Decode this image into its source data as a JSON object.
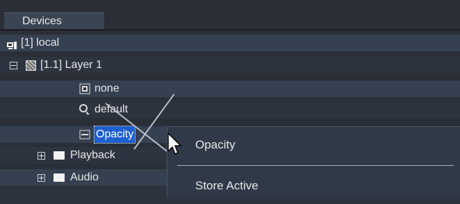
{
  "tab": {
    "label": "Devices"
  },
  "tree": {
    "device": {
      "label": "[1] local"
    },
    "layer": {
      "label": "[1.1] Layer 1"
    },
    "children": [
      {
        "label": "none"
      },
      {
        "label": "default"
      },
      {
        "label": "Opacity"
      }
    ],
    "folders": [
      {
        "label": "Playback"
      },
      {
        "label": "Audio"
      }
    ]
  },
  "context_menu": {
    "items": [
      {
        "label": "Opacity"
      },
      {
        "label": "Store Active"
      }
    ]
  },
  "colors": {
    "selection": "#1d5fd0",
    "background": "#2a2f37"
  }
}
